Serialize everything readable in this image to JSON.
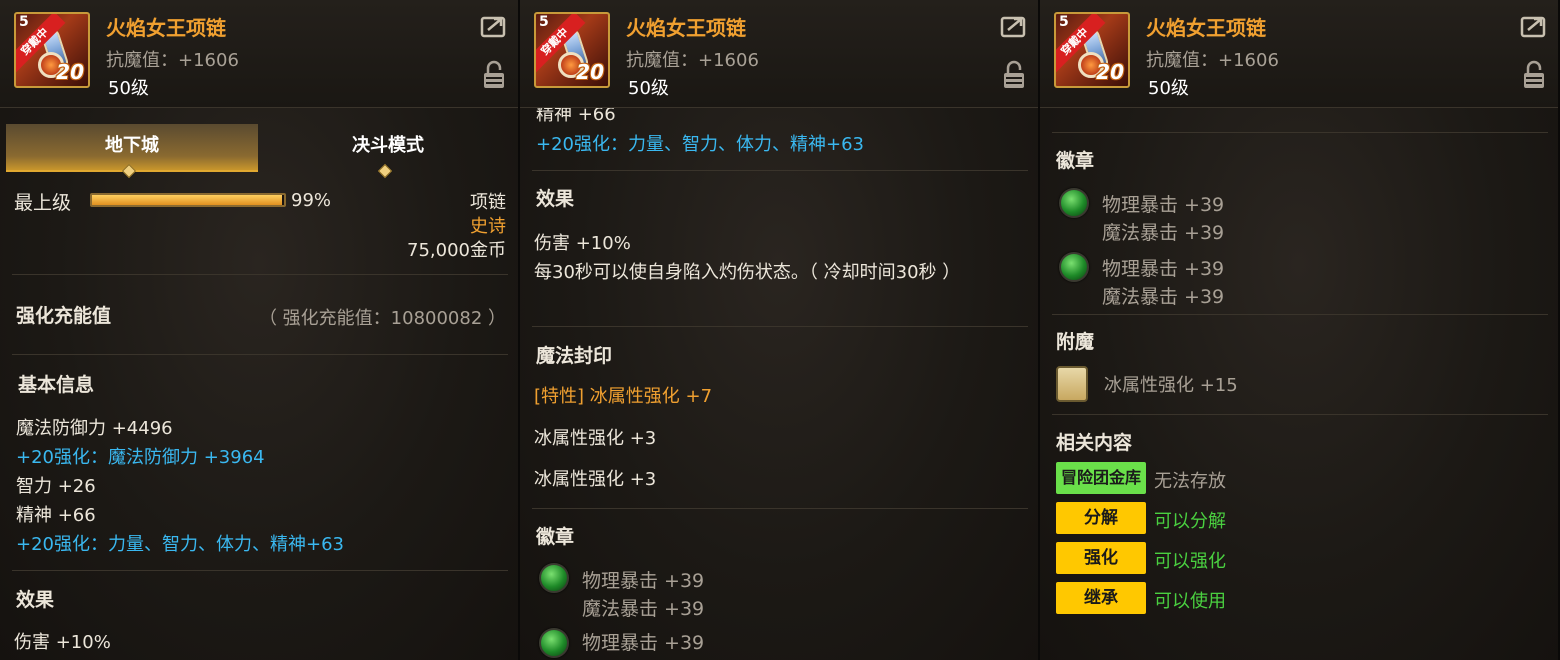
{
  "item": {
    "name": "火焰女王项链",
    "resist": "抗魔值：+1606",
    "level": "50级",
    "icon_badge": "穿戴中",
    "icon_corner": "5",
    "icon_number": "20"
  },
  "panel1": {
    "tabs": [
      "地下城",
      "决斗模式"
    ],
    "grade_label": "最上级",
    "grade_percent_text": "99%",
    "grade_percent": 0.99,
    "slot": "项链",
    "rarity": "史诗",
    "price": "75,000金币",
    "charge_title": "强化充能值",
    "charge_value": "（ 强化充能值：10800082 ）",
    "basic_title": "基本信息",
    "basic_lines": [
      "魔法防御力 +4496",
      "+20强化：魔法防御力 +3964",
      "智力 +26",
      "精神 +66",
      "+20强化：力量、智力、体力、精神+63"
    ],
    "effect_title": "效果",
    "effect_cut": "伤害 +10%"
  },
  "panel2": {
    "top_cut": "精神 +66",
    "enhance_line": "+20强化：力量、智力、体力、精神+63",
    "effect_title": "效果",
    "effect_lines": [
      "伤害 +10%",
      "每30秒可以使自身陷入灼伤状态。（ 冷却时间30秒 ）"
    ],
    "seal_title": "魔法封印",
    "seal_lines": [
      "[特性] 冰属性强化 +7",
      "冰属性强化 +3",
      "冰属性强化 +3"
    ],
    "emblem_title": "徽章",
    "emblem_lines": [
      "物理暴击 +39",
      "魔法暴击 +39",
      "物理暴击 +39"
    ]
  },
  "panel3": {
    "emblem_title": "徽章",
    "emblems": [
      [
        "物理暴击 +39",
        "魔法暴击 +39"
      ],
      [
        "物理暴击 +39",
        "魔法暴击 +39"
      ]
    ],
    "enchant_title": "附魔",
    "enchant_value": "冰属性强化 +15",
    "related_title": "相关内容",
    "related": [
      {
        "tag": "冒险团金库",
        "value": "无法存放"
      },
      {
        "tag": "分解",
        "value": "可以分解"
      },
      {
        "tag": "强化",
        "value": "可以强化"
      },
      {
        "tag": "继承",
        "value": "可以使用"
      }
    ]
  },
  "colors": {
    "gold": "#f0a030",
    "cyan": "#3ab8f0",
    "green": "#4ad040",
    "tag_yellow": "#ffc800",
    "tag_green": "#6ae04a"
  }
}
